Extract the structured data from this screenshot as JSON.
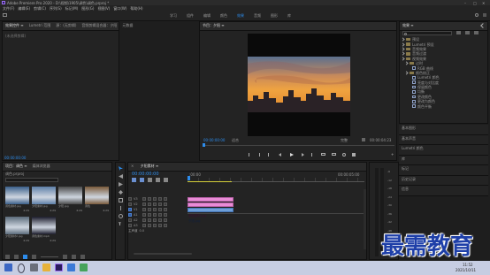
{
  "app": {
    "title": "Adobe Premiere Pro 2020 - D:\\视频\\1905\\调色\\调色.prproj *",
    "window_controls": [
      "–",
      "□",
      "✕"
    ]
  },
  "menu": [
    "文件(F)",
    "编辑(E)",
    "剪辑(C)",
    "序列(S)",
    "标记(M)",
    "图形(G)",
    "视图(V)",
    "窗口(W)",
    "帮助(H)"
  ],
  "workspaces": [
    "学习",
    "组件",
    "编辑",
    "颜色",
    "效果",
    "音频",
    "图形",
    "库"
  ],
  "workspace_active_index": 4,
  "source_panel": {
    "tabs": [
      "效果控件 ≡",
      "Lumetri 范围",
      "源：(无剪辑)",
      "音频剪辑混合器：夕阳",
      "元数据"
    ],
    "label": "(未选择剪辑)",
    "timecode": "00:00:00:00"
  },
  "program": {
    "tab": "节目：夕阳 ≡",
    "timecode_left": "00:00:00:00",
    "fit": "适合",
    "quality": "完整",
    "timecode_right": "00:00:04:23"
  },
  "effects": {
    "tab": "效果 ≡",
    "items": [
      {
        "label": "预设",
        "kind": "folder",
        "indent": 0
      },
      {
        "label": "Lumetri 预设",
        "kind": "folder",
        "indent": 0
      },
      {
        "label": "音频效果",
        "kind": "folder",
        "indent": 0
      },
      {
        "label": "音频过渡",
        "kind": "folder",
        "indent": 0
      },
      {
        "label": "视频效果",
        "kind": "folder",
        "indent": 0
      },
      {
        "label": "过时",
        "kind": "folder",
        "indent": 1
      },
      {
        "label": "RGB 曲线",
        "kind": "fx",
        "indent": 2
      },
      {
        "label": "颜色校正",
        "kind": "folder",
        "indent": 1
      },
      {
        "label": "Lumetri 颜色",
        "kind": "fx",
        "indent": 2
      },
      {
        "label": "亮度与对比度",
        "kind": "fx",
        "indent": 2
      },
      {
        "label": "保留颜色",
        "kind": "fx",
        "indent": 2
      },
      {
        "label": "均衡",
        "kind": "fx",
        "indent": 2
      },
      {
        "label": "更改颜色",
        "kind": "fx",
        "indent": 2
      },
      {
        "label": "更改为颜色",
        "kind": "fx",
        "indent": 2
      },
      {
        "label": "颜色平衡",
        "kind": "fx",
        "indent": 2
      }
    ],
    "sections": [
      "基本图形",
      "基本声音",
      "Lumetri 颜色",
      "库",
      "标记",
      "历史记录",
      "信息"
    ]
  },
  "project": {
    "tabs": [
      "项目：调色 ≡",
      "媒体浏览器"
    ],
    "file": "调色.prproj",
    "items": [
      {
        "name": "调色素材.jpg",
        "duration": "4:29"
      },
      {
        "name": "夕阳素材.jpg",
        "duration": "4:29"
      },
      {
        "name": "夕阳.jpg",
        "duration": "4:29"
      },
      {
        "name": "调色",
        "duration": "4:29"
      },
      {
        "name": "夕阳素材2.jpg",
        "duration": "4:29"
      },
      {
        "name": "调色素材.mp4",
        "duration": "4:29"
      }
    ]
  },
  "timeline": {
    "tab": "夕阳素材 ≡",
    "timecode": "00:00:00:00",
    "ruler": [
      ":00:00",
      "00:00:05:00"
    ],
    "tracks": [
      "V3",
      "V2",
      "V1",
      "A1",
      "A2",
      "A3"
    ],
    "master": "主声道",
    "master_value": "0.0",
    "clips": [
      {
        "label": "夕阳素材2.jpg",
        "track": "V3"
      },
      {
        "label": "调色素材.jpg",
        "track": "V2"
      },
      {
        "label": "夕阳.jpg",
        "track": "V1"
      }
    ]
  },
  "meter": {
    "labels": [
      "-6",
      "-12",
      "-18",
      "-24",
      "-30",
      "-36",
      "-42",
      "-48",
      "-54",
      "dB"
    ]
  },
  "watermark": "最需教育",
  "taskbar": {
    "time": "11:52",
    "date": "2021/10/11"
  },
  "colors": {
    "accent": "#2d8ceb",
    "clip_pink": "#e88cd6",
    "clip_blue": "#6e9fd8",
    "watermark": "#1e3fa8"
  }
}
